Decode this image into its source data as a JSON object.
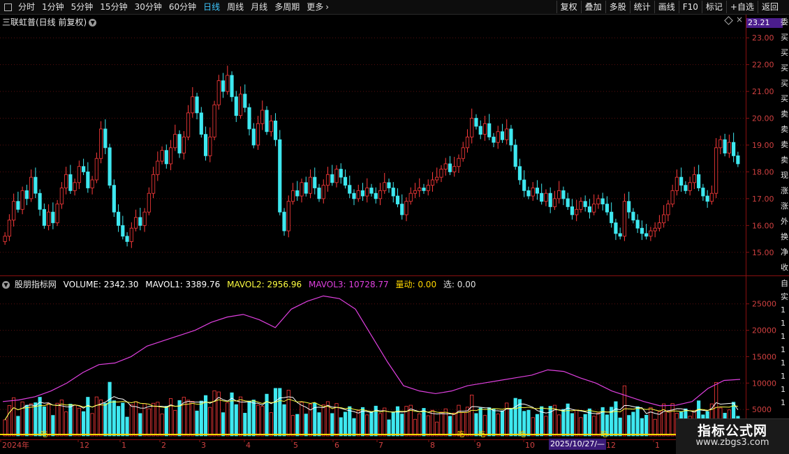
{
  "toolbar": {
    "periods": [
      "分时",
      "1分钟",
      "5分钟",
      "15分钟",
      "30分钟",
      "60分钟",
      "日线",
      "周线",
      "月线",
      "多周期",
      "更多"
    ],
    "active_period": "日线",
    "more_chevron": "›",
    "right_buttons": [
      "复权",
      "叠加",
      "多股",
      "统计",
      "画线",
      "F10",
      "标记",
      "+自选",
      "返回"
    ]
  },
  "price_panel": {
    "title": "三联虹普(日线 前复权)",
    "collapse_icon": "chevron-down-icon",
    "last_price_tag": "23.21",
    "y_ticks": [
      "23.00",
      "22.00",
      "21.00",
      "20.00",
      "19.00",
      "18.00",
      "17.00",
      "16.00",
      "15.00"
    ],
    "right_strip_chars": [
      "委",
      "买",
      "买",
      "买",
      "买",
      "买",
      "卖",
      "卖",
      "卖",
      "卖",
      "现",
      "涨",
      "涨",
      "外",
      "换",
      "净",
      "收"
    ]
  },
  "volume_panel": {
    "indicator": "股朋指标网",
    "volume_label": "VOLUME: 2342.30",
    "mavol1_label": "MAVOL1: 3389.76",
    "mavol2_label": "MAVOL2: 2956.96",
    "mavol3_label": "MAVOL3: 10728.77",
    "liangdong_label": "量动: 0.00",
    "xuan_label": "选: 0.00",
    "y_ticks": [
      "25000",
      "20000",
      "15000",
      "10000",
      "5000"
    ],
    "right_strip_chars": [
      "自",
      "实",
      "1",
      "1",
      "1",
      "1",
      "1",
      "1",
      "1",
      "1"
    ],
    "markers": [
      "吃",
      "吃",
      "吃",
      "吃",
      "吃"
    ]
  },
  "date_axis": {
    "labels": [
      "2024年",
      "12",
      "1",
      "2",
      "3",
      "4",
      "5",
      "6",
      "7",
      "8",
      "9",
      "10",
      "11",
      "12",
      "1"
    ],
    "highlight": "2025/10/27/—"
  },
  "colors": {
    "up": "#ff3b3b",
    "down": "#3ee8f0",
    "mavol1": "#ffffff",
    "mavol2": "#ffff40",
    "mavol3": "#e040e0",
    "liangdong": "#ffd700",
    "axis": "#8a1010",
    "tag": "#4b1d8c"
  },
  "chart_data": {
    "type": "candlestick",
    "title": "三联虹普(日线 前复权)",
    "ylim": [
      14.5,
      23.5
    ],
    "candles": [
      {
        "x": "2024-11",
        "close": 15.6
      },
      {
        "x": "2024-11",
        "close": 16.2
      },
      {
        "x": "2024-11",
        "close": 16.9
      },
      {
        "x": "2024-11",
        "close": 16.6
      },
      {
        "x": "2024-11",
        "close": 17.3
      },
      {
        "x": "2024-11",
        "close": 17.0
      },
      {
        "x": "2024-11",
        "close": 17.8
      },
      {
        "x": "2024-11",
        "close": 17.2
      },
      {
        "x": "2024-11",
        "close": 16.6
      },
      {
        "x": "2024-11",
        "close": 16.0
      },
      {
        "x": "2024-11",
        "close": 16.5
      },
      {
        "x": "2024-12",
        "close": 16.1
      },
      {
        "x": "2024-12",
        "close": 16.8
      },
      {
        "x": "2024-12",
        "close": 17.4
      },
      {
        "x": "2024-12",
        "close": 17.9
      },
      {
        "x": "2024-12",
        "close": 17.3
      },
      {
        "x": "2024-12",
        "close": 17.6
      },
      {
        "x": "2024-12",
        "close": 18.2
      },
      {
        "x": "2024-12",
        "close": 18.0
      },
      {
        "x": "2024-12",
        "close": 17.4
      },
      {
        "x": "2024-12",
        "close": 17.7
      },
      {
        "x": "2024-12",
        "close": 18.5
      },
      {
        "x": "2024-12",
        "close": 19.6
      },
      {
        "x": "2024-12",
        "close": 18.9
      },
      {
        "x": "2024-12",
        "close": 17.5
      },
      {
        "x": "2025-01",
        "close": 16.5
      },
      {
        "x": "2025-01",
        "close": 16.0
      },
      {
        "x": "2025-01",
        "close": 15.6
      },
      {
        "x": "2025-01",
        "close": 15.4
      },
      {
        "x": "2025-01",
        "close": 15.9
      },
      {
        "x": "2025-01",
        "close": 16.3
      },
      {
        "x": "2025-01",
        "close": 16.0
      },
      {
        "x": "2025-01",
        "close": 16.5
      },
      {
        "x": "2025-01",
        "close": 17.2
      },
      {
        "x": "2025-01",
        "close": 17.9
      },
      {
        "x": "2025-02",
        "close": 18.4
      },
      {
        "x": "2025-02",
        "close": 18.8
      },
      {
        "x": "2025-02",
        "close": 18.3
      },
      {
        "x": "2025-02",
        "close": 18.9
      },
      {
        "x": "2025-02",
        "close": 19.4
      },
      {
        "x": "2025-02",
        "close": 18.7
      },
      {
        "x": "2025-02",
        "close": 19.3
      },
      {
        "x": "2025-02",
        "close": 20.2
      },
      {
        "x": "2025-02",
        "close": 20.8
      },
      {
        "x": "2025-02",
        "close": 20.2
      },
      {
        "x": "2025-02",
        "close": 19.4
      },
      {
        "x": "2025-02",
        "close": 18.6
      },
      {
        "x": "2025-03",
        "close": 19.3
      },
      {
        "x": "2025-03",
        "close": 20.5
      },
      {
        "x": "2025-03",
        "close": 21.4
      },
      {
        "x": "2025-03",
        "close": 21.0
      },
      {
        "x": "2025-03",
        "close": 21.6
      },
      {
        "x": "2025-03",
        "close": 20.8
      },
      {
        "x": "2025-03",
        "close": 20.1
      },
      {
        "x": "2025-03",
        "close": 20.9
      },
      {
        "x": "2025-03",
        "close": 20.4
      },
      {
        "x": "2025-03",
        "close": 19.6
      },
      {
        "x": "2025-03",
        "close": 19.0
      },
      {
        "x": "2025-03",
        "close": 19.8
      },
      {
        "x": "2025-03",
        "close": 20.3
      },
      {
        "x": "2025-03",
        "close": 19.5
      },
      {
        "x": "2025-04",
        "close": 19.9
      },
      {
        "x": "2025-04",
        "close": 19.2
      },
      {
        "x": "2025-04",
        "close": 16.5
      },
      {
        "x": "2025-04",
        "close": 15.8
      },
      {
        "x": "2025-04",
        "close": 16.9
      },
      {
        "x": "2025-04",
        "close": 17.3
      },
      {
        "x": "2025-04",
        "close": 17.1
      },
      {
        "x": "2025-04",
        "close": 17.6
      },
      {
        "x": "2025-04",
        "close": 17.2
      },
      {
        "x": "2025-04",
        "close": 17.8
      },
      {
        "x": "2025-04",
        "close": 17.4
      },
      {
        "x": "2025-05",
        "close": 17.0
      },
      {
        "x": "2025-05",
        "close": 17.5
      },
      {
        "x": "2025-05",
        "close": 17.9
      },
      {
        "x": "2025-05",
        "close": 17.6
      },
      {
        "x": "2025-05",
        "close": 18.1
      },
      {
        "x": "2025-05",
        "close": 17.8
      },
      {
        "x": "2025-05",
        "close": 17.5
      },
      {
        "x": "2025-05",
        "close": 17.2
      },
      {
        "x": "2025-05",
        "close": 17.0
      },
      {
        "x": "2025-05",
        "close": 17.3
      },
      {
        "x": "2025-05",
        "close": 17.1
      },
      {
        "x": "2025-06",
        "close": 17.4
      },
      {
        "x": "2025-06",
        "close": 17.2
      },
      {
        "x": "2025-06",
        "close": 17.0
      },
      {
        "x": "2025-06",
        "close": 17.3
      },
      {
        "x": "2025-06",
        "close": 17.6
      },
      {
        "x": "2025-06",
        "close": 17.4
      },
      {
        "x": "2025-06",
        "close": 17.1
      },
      {
        "x": "2025-06",
        "close": 16.8
      },
      {
        "x": "2025-06",
        "close": 16.4
      },
      {
        "x": "2025-06",
        "close": 16.9
      },
      {
        "x": "2025-07",
        "close": 17.2
      },
      {
        "x": "2025-07",
        "close": 17.3
      },
      {
        "x": "2025-07",
        "close": 17.4
      },
      {
        "x": "2025-07",
        "close": 17.3
      },
      {
        "x": "2025-07",
        "close": 17.5
      },
      {
        "x": "2025-07",
        "close": 17.7
      },
      {
        "x": "2025-07",
        "close": 17.8
      },
      {
        "x": "2025-07",
        "close": 18.1
      },
      {
        "x": "2025-07",
        "close": 18.3
      },
      {
        "x": "2025-07",
        "close": 18.0
      },
      {
        "x": "2025-07",
        "close": 18.2
      },
      {
        "x": "2025-08",
        "close": 18.5
      },
      {
        "x": "2025-08",
        "close": 18.9
      },
      {
        "x": "2025-08",
        "close": 19.3
      },
      {
        "x": "2025-08",
        "close": 20.0
      },
      {
        "x": "2025-08",
        "close": 19.7
      },
      {
        "x": "2025-08",
        "close": 19.4
      },
      {
        "x": "2025-08",
        "close": 19.8
      },
      {
        "x": "2025-08",
        "close": 19.3
      },
      {
        "x": "2025-08",
        "close": 19.1
      },
      {
        "x": "2025-08",
        "close": 19.5
      },
      {
        "x": "2025-08",
        "close": 19.2
      },
      {
        "x": "2025-08",
        "close": 19.6
      },
      {
        "x": "2025-09",
        "close": 19.0
      },
      {
        "x": "2025-09",
        "close": 18.2
      },
      {
        "x": "2025-09",
        "close": 17.7
      },
      {
        "x": "2025-09",
        "close": 17.3
      },
      {
        "x": "2025-09",
        "close": 17.1
      },
      {
        "x": "2025-09",
        "close": 17.4
      },
      {
        "x": "2025-09",
        "close": 17.2
      },
      {
        "x": "2025-09",
        "close": 16.9
      },
      {
        "x": "2025-09",
        "close": 17.2
      },
      {
        "x": "2025-09",
        "close": 16.7
      },
      {
        "x": "2025-10",
        "close": 17.0
      },
      {
        "x": "2025-10",
        "close": 17.3
      },
      {
        "x": "2025-10",
        "close": 17.0
      },
      {
        "x": "2025-10",
        "close": 16.7
      },
      {
        "x": "2025-10",
        "close": 16.4
      },
      {
        "x": "2025-10",
        "close": 16.6
      },
      {
        "x": "2025-10",
        "close": 16.9
      },
      {
        "x": "2025-10",
        "close": 16.7
      },
      {
        "x": "2025-10",
        "close": 16.5
      },
      {
        "x": "2025-10",
        "close": 16.8
      },
      {
        "x": "2025-10",
        "close": 17.0
      },
      {
        "x": "2025-11",
        "close": 16.8
      },
      {
        "x": "2025-11",
        "close": 16.5
      },
      {
        "x": "2025-11",
        "close": 16.1
      },
      {
        "x": "2025-11",
        "close": 15.7
      },
      {
        "x": "2025-11",
        "close": 15.6
      },
      {
        "x": "2025-11",
        "close": 16.9
      },
      {
        "x": "2025-11",
        "close": 16.5
      },
      {
        "x": "2025-11",
        "close": 16.2
      },
      {
        "x": "2025-11",
        "close": 15.9
      },
      {
        "x": "2025-11",
        "close": 15.7
      },
      {
        "x": "2025-12",
        "close": 15.6
      },
      {
        "x": "2025-12",
        "close": 15.8
      },
      {
        "x": "2025-12",
        "close": 15.9
      },
      {
        "x": "2025-12",
        "close": 16.1
      },
      {
        "x": "2025-12",
        "close": 16.4
      },
      {
        "x": "2025-12",
        "close": 16.8
      },
      {
        "x": "2025-12",
        "close": 17.3
      },
      {
        "x": "2025-12",
        "close": 17.8
      },
      {
        "x": "2025-12",
        "close": 17.5
      },
      {
        "x": "2025-12",
        "close": 17.3
      },
      {
        "x": "2025-12",
        "close": 17.6
      },
      {
        "x": "2025-12",
        "close": 17.9
      },
      {
        "x": "2026-01",
        "close": 17.4
      },
      {
        "x": "2026-01",
        "close": 17.1
      },
      {
        "x": "2026-01",
        "close": 16.9
      },
      {
        "x": "2026-01",
        "close": 17.2
      },
      {
        "x": "2026-01",
        "close": 18.9
      },
      {
        "x": "2026-01",
        "close": 19.2
      },
      {
        "x": "2026-01",
        "close": 18.7
      },
      {
        "x": "2026-01",
        "close": 19.1
      },
      {
        "x": "2026-01",
        "close": 18.6
      },
      {
        "x": "2026-01",
        "close": 18.3
      }
    ],
    "mavol3": [
      6500,
      6800,
      7400,
      8500,
      10000,
      12000,
      13500,
      13800,
      15000,
      17000,
      18000,
      19000,
      20000,
      21500,
      22500,
      23000,
      22000,
      20500,
      24000,
      25500,
      26500,
      26000,
      24000,
      19000,
      14000,
      9500,
      8500,
      8000,
      8500,
      9500,
      10000,
      10500,
      11000,
      11500,
      12500,
      12200,
      11000,
      10000,
      8500,
      7500,
      6500,
      5700,
      5800,
      6500,
      9000,
      10500,
      10700
    ],
    "mavol3_ylim": [
      0,
      28000
    ]
  }
}
